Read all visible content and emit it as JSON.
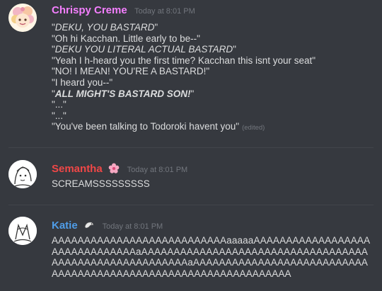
{
  "messages": [
    {
      "username": "Chrispy Creme",
      "username_color": "#f47fff",
      "timestamp": "Today at 8:01 PM",
      "lines": [
        {
          "q1": "\"",
          "em": "DEKU, YOU BASTARD",
          "q2": "\""
        },
        {
          "text": "\"Oh hi Kacchan. Little early to be--\""
        },
        {
          "q1": "\"",
          "em": "DEKU YOU LITERAL ACTUAL BASTARD",
          "q2": "\""
        },
        {
          "text": "\"Yeah I h-heard you the first time? Kacchan this isnt your seat\""
        },
        {
          "text": "\"NO! I MEAN! YOU'RE A BASTARD!\""
        },
        {
          "text": "\"I heard you--\""
        },
        {
          "q1": "\"",
          "em": "ALL MIGHT'S BASTARD SON!",
          "q2": "\""
        },
        {
          "text": "\"...\""
        },
        {
          "text": "\"...\""
        },
        {
          "text": "\"You've been talking to Todoroki havent you\""
        }
      ],
      "edited_label": "(edited)"
    },
    {
      "username": "Semantha",
      "username_color": "#f04747",
      "timestamp": "Today at 8:01 PM",
      "text": "SCREAMSSSSSSSSS"
    },
    {
      "username": "Katie",
      "username_color": "#4f9de8",
      "timestamp": "Today at 8:01 PM",
      "text": "AAAAAAAAAAAAAAAAAAAAAAAAAAAaaaaaAAAAAAAAAAAAAAAAAAAAAAAAAAAAAAAaAAAAAAAAAAAAAAAAAAAAAAAAAAAAAAAAAAAAAAAAAAAAAAAAAAAAAAAAaAAAAAAAAAAAAAAAAAAAAAAAAAAAAAAAAAAAAAAAAAAAAAAAAAAAAAAAAAAAAAAAA"
    }
  ]
}
